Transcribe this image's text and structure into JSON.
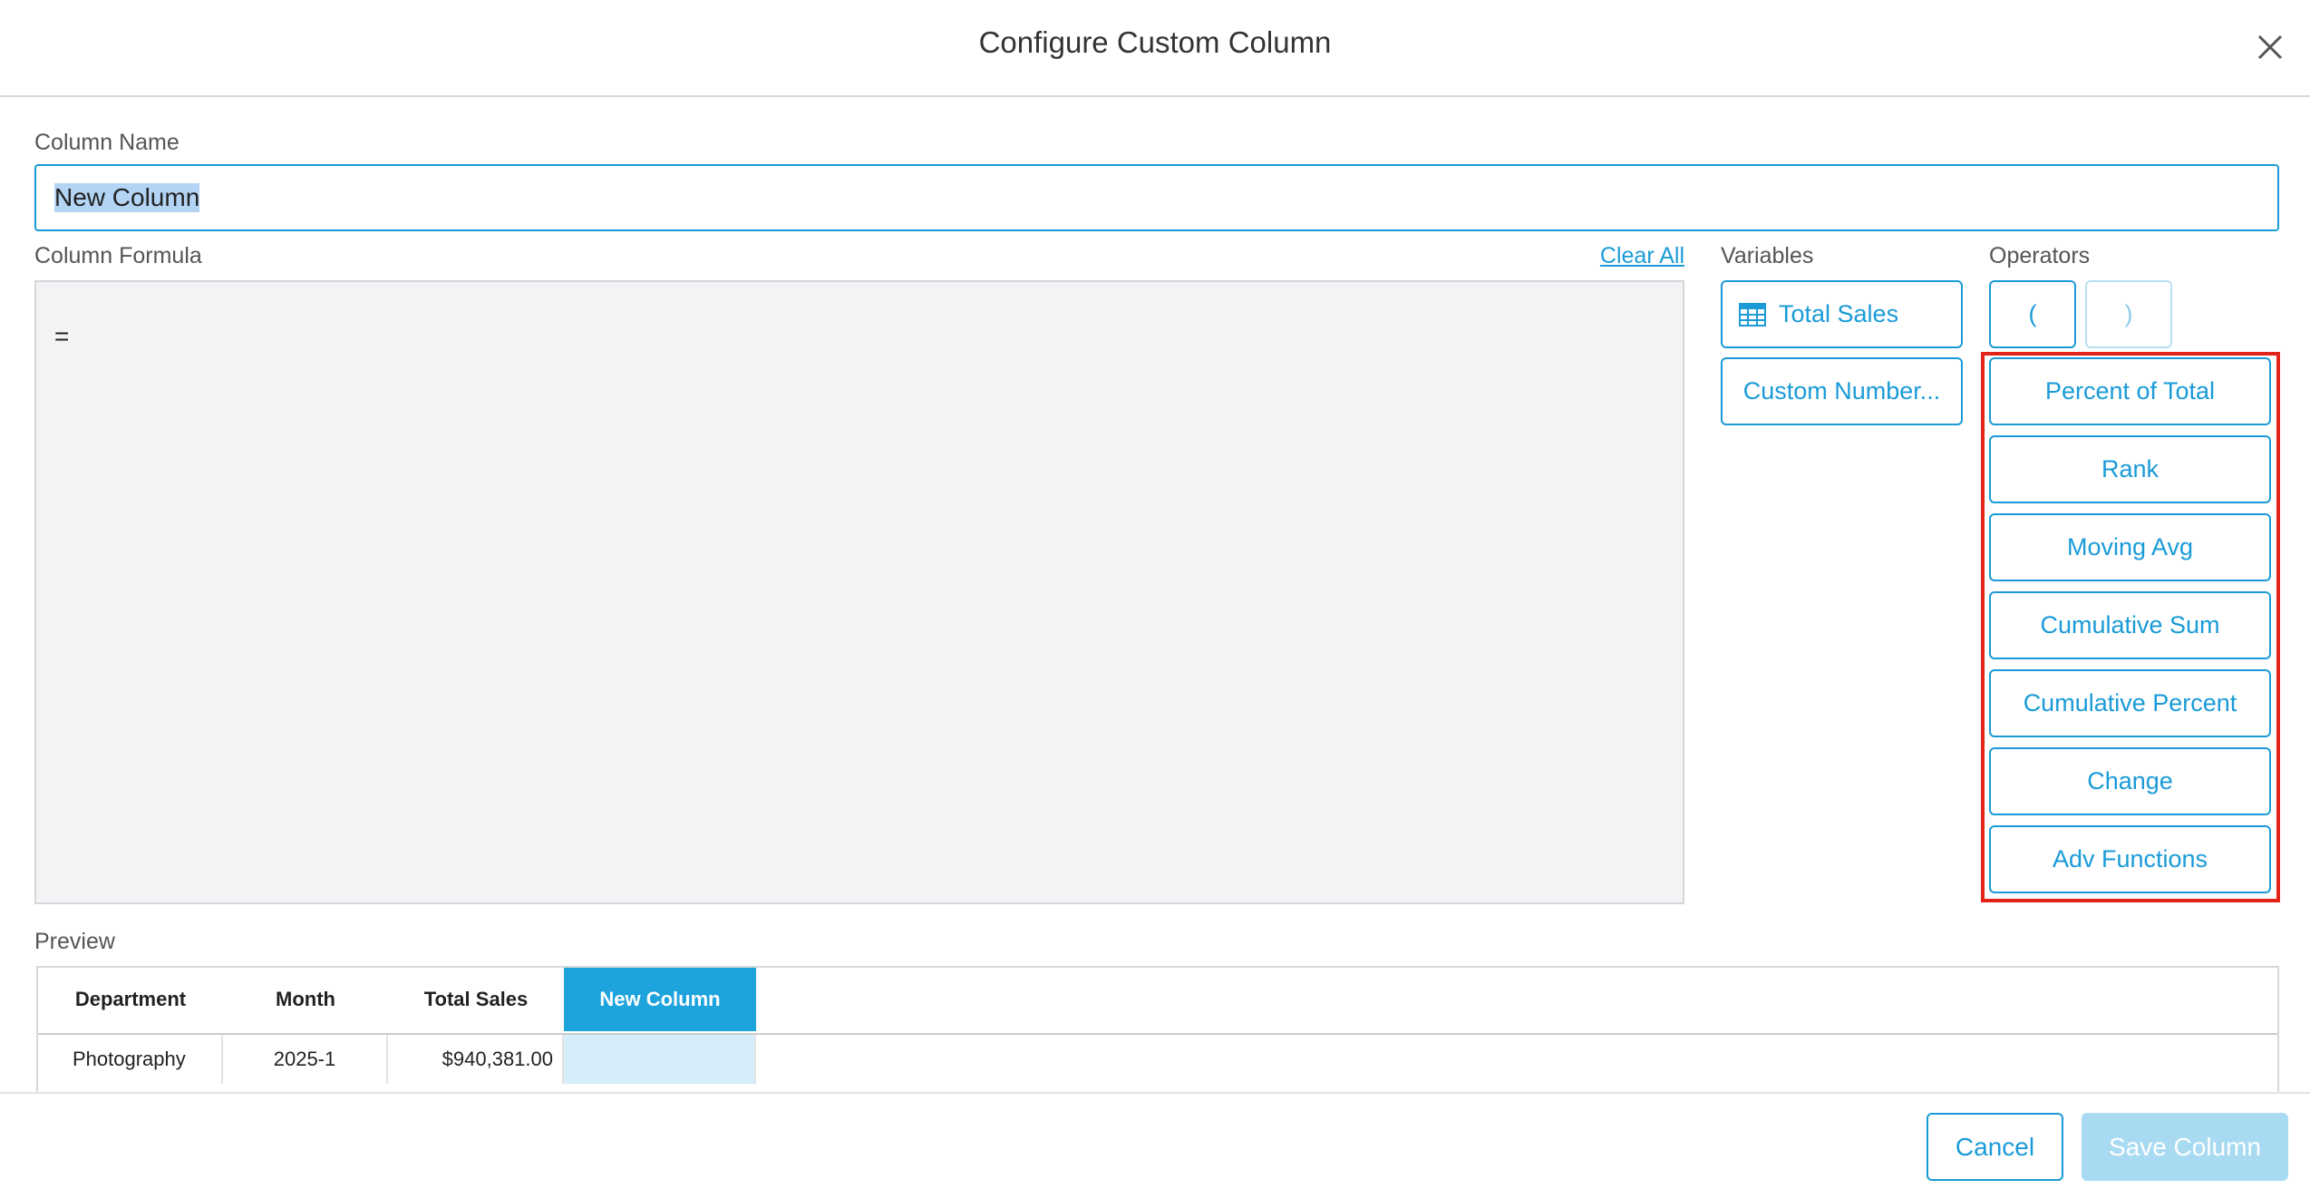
{
  "dialog": {
    "title": "Configure Custom Column"
  },
  "column_name": {
    "label": "Column Name",
    "value": "New Column"
  },
  "formula": {
    "label": "Column Formula",
    "clear_all": "Clear All",
    "content": "="
  },
  "variables": {
    "label": "Variables",
    "items": [
      {
        "label": "Total Sales",
        "icon": "table-icon"
      },
      {
        "label": "Custom Number..."
      }
    ]
  },
  "operators": {
    "label": "Operators",
    "parens": [
      "(",
      ")"
    ],
    "items": [
      "Percent of Total",
      "Rank",
      "Moving Avg",
      "Cumulative Sum",
      "Cumulative Percent",
      "Change",
      "Adv Functions"
    ]
  },
  "preview": {
    "label": "Preview",
    "columns": [
      "Department",
      "Month",
      "Total Sales",
      "New Column"
    ],
    "rows": [
      [
        "Photography",
        "2025-1",
        "$940,381.00",
        ""
      ]
    ]
  },
  "footer": {
    "cancel": "Cancel",
    "save": "Save Column"
  },
  "colors": {
    "accent": "#1a9bd7",
    "highlight": "#e2231a",
    "header_active": "#1ea4dd"
  }
}
